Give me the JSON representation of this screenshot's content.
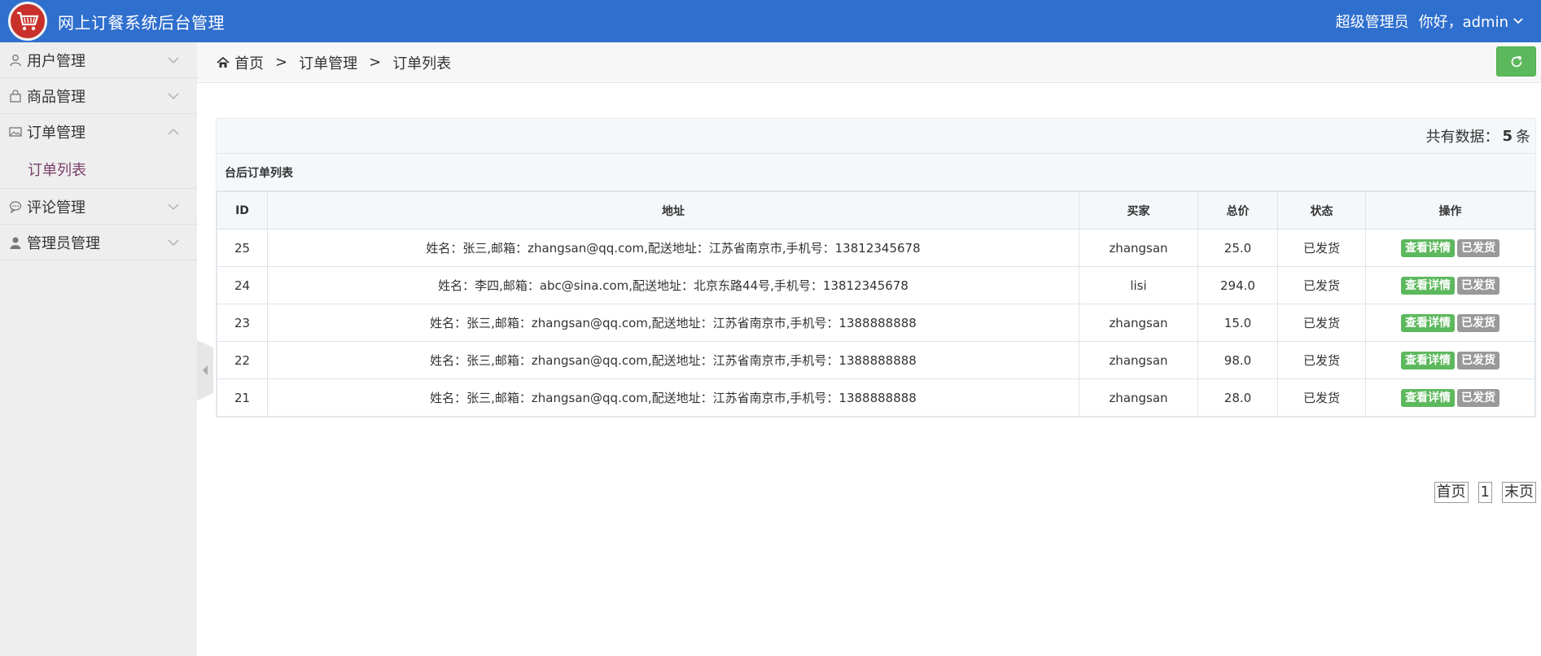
{
  "header": {
    "app_title": "网上订餐系统后台管理",
    "role": "超级管理员",
    "greeting": "你好，admin"
  },
  "sidebar": {
    "items": [
      {
        "label": "用户管理",
        "icon": "user-icon"
      },
      {
        "label": "商品管理",
        "icon": "bag-icon"
      },
      {
        "label": "订单管理",
        "icon": "image-icon",
        "expanded": true,
        "children": [
          {
            "label": "订单列表"
          }
        ]
      },
      {
        "label": "评论管理",
        "icon": "chat-icon"
      },
      {
        "label": "管理员管理",
        "icon": "person-icon"
      }
    ]
  },
  "breadcrumb": {
    "home": "首页",
    "sep": ">",
    "level1": "订单管理",
    "level2": "订单列表"
  },
  "summary": {
    "prefix": "共有数据：",
    "count": "5",
    "suffix": "条"
  },
  "table": {
    "caption": "台后订单列表",
    "headers": [
      "ID",
      "地址",
      "买家",
      "总价",
      "状态",
      "操作"
    ],
    "detail_label": "查看详情",
    "shipped_label": "已发货",
    "rows": [
      {
        "id": "25",
        "address": "姓名：张三,邮箱：zhangsan@qq.com,配送地址：江苏省南京市,手机号：13812345678",
        "buyer": "zhangsan",
        "total": "25.0",
        "status": "已发货"
      },
      {
        "id": "24",
        "address": "姓名：李四,邮箱：abc@sina.com,配送地址：北京东路44号,手机号：13812345678",
        "buyer": "lisi",
        "total": "294.0",
        "status": "已发货"
      },
      {
        "id": "23",
        "address": "姓名：张三,邮箱：zhangsan@qq.com,配送地址：江苏省南京市,手机号：1388888888",
        "buyer": "zhangsan",
        "total": "15.0",
        "status": "已发货"
      },
      {
        "id": "22",
        "address": "姓名：张三,邮箱：zhangsan@qq.com,配送地址：江苏省南京市,手机号：1388888888",
        "buyer": "zhangsan",
        "total": "98.0",
        "status": "已发货"
      },
      {
        "id": "21",
        "address": "姓名：张三,邮箱：zhangsan@qq.com,配送地址：江苏省南京市,手机号：1388888888",
        "buyer": "zhangsan",
        "total": "28.0",
        "status": "已发货"
      }
    ]
  },
  "pager": {
    "first": "首页",
    "page": "1",
    "last": "末页"
  },
  "colors": {
    "header_bg": "#2f6fce",
    "action_green": "#5cb85c",
    "action_gray": "#999999",
    "submenu_text": "#7a3f6a"
  }
}
